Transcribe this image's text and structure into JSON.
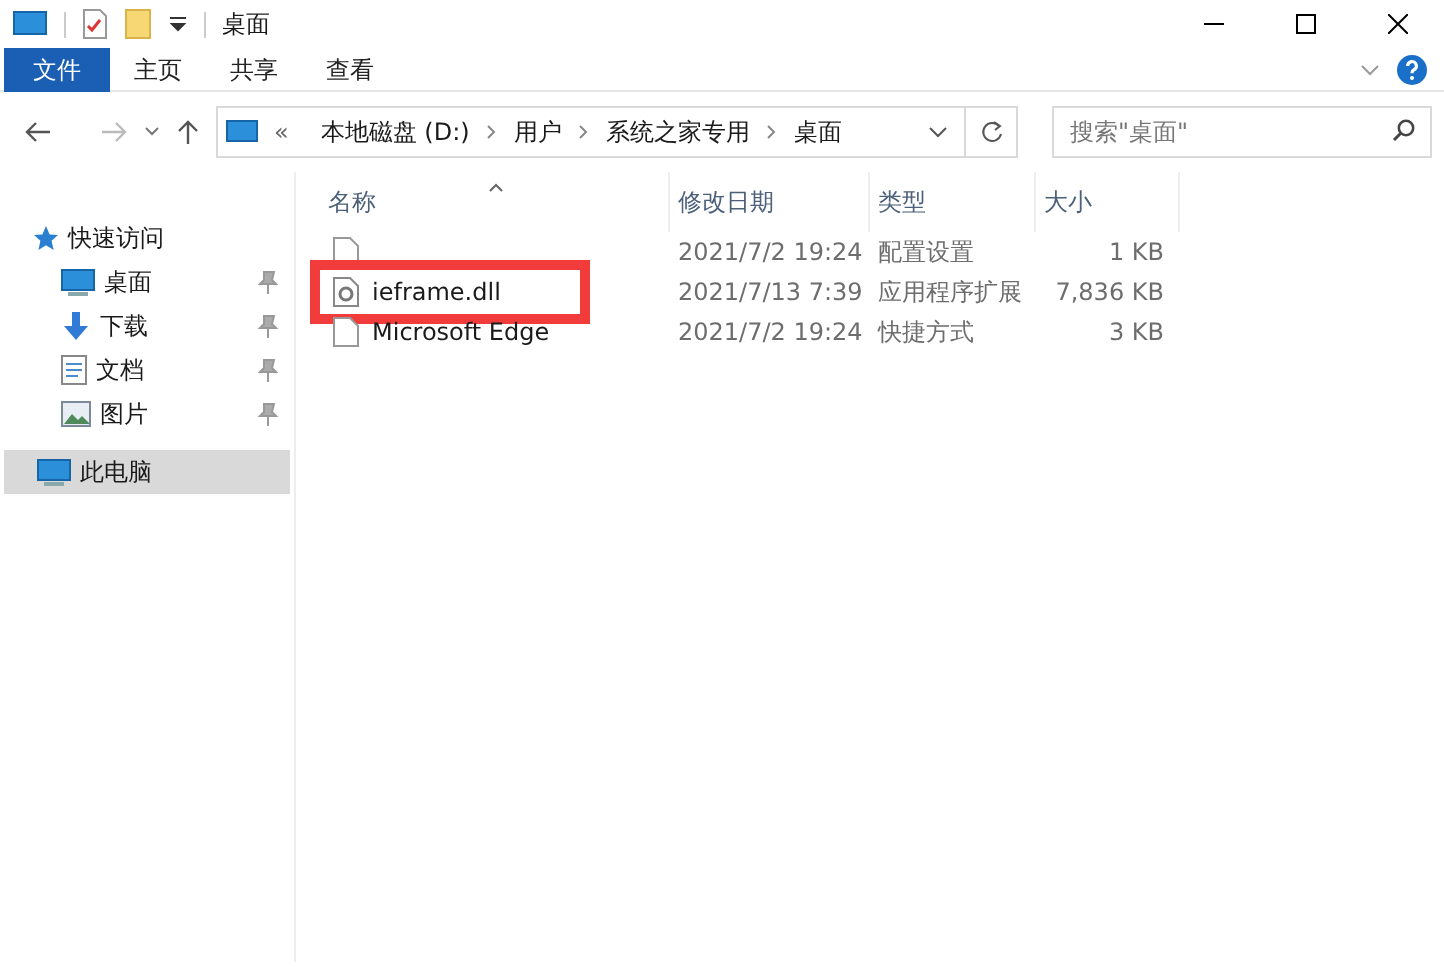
{
  "window": {
    "title": "桌面"
  },
  "ribbon": {
    "tabs": [
      {
        "label": "文件",
        "kind": "file"
      },
      {
        "label": "主页",
        "kind": "tab"
      },
      {
        "label": "共享",
        "kind": "tab"
      },
      {
        "label": "查看",
        "kind": "tab"
      }
    ]
  },
  "address": {
    "overflow": "«",
    "path": [
      "本地磁盘 (D:)",
      "用户",
      "系统之家专用",
      "桌面"
    ]
  },
  "search": {
    "placeholder": "搜索\"桌面\""
  },
  "sidebar": {
    "items": [
      {
        "label": "快速访问",
        "pinned": false,
        "selected": false,
        "kind": "group"
      },
      {
        "label": "桌面",
        "pinned": true,
        "selected": false,
        "kind": "item"
      },
      {
        "label": "下载",
        "pinned": true,
        "selected": false,
        "kind": "item"
      },
      {
        "label": "文档",
        "pinned": true,
        "selected": false,
        "kind": "item"
      },
      {
        "label": "图片",
        "pinned": true,
        "selected": false,
        "kind": "item"
      },
      {
        "label": "此电脑",
        "pinned": false,
        "selected": true,
        "kind": "group"
      }
    ]
  },
  "table": {
    "columns": [
      "名称",
      "修改日期",
      "类型",
      "大小"
    ],
    "rows": [
      {
        "date": "2021/7/2 19:24",
        "type": "配置设置",
        "size": "1 KB",
        "highlighted": false
      },
      {
        "name": "ieframe.dll",
        "date": "2021/7/13 7:39",
        "type": "应用程序扩展",
        "size": "7,836 KB",
        "highlighted": true
      },
      {
        "name": "Microsoft Edge",
        "date": "2021/7/2 19:24",
        "type": "快捷方式",
        "size": "3 KB",
        "highlighted": false
      }
    ]
  }
}
